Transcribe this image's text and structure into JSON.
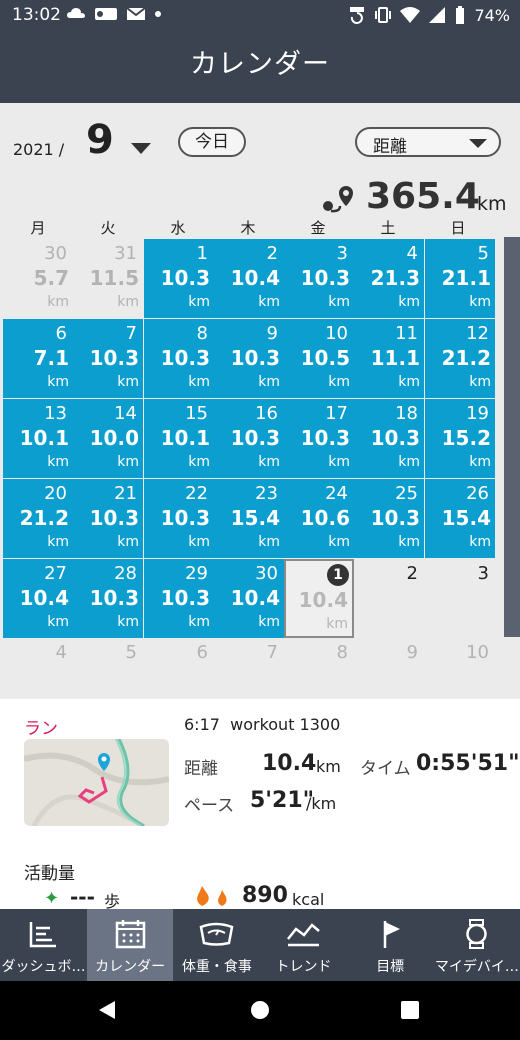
{
  "status_bar": {
    "time": "13:02",
    "battery": "74%",
    "left_icons": [
      "cloud-icon",
      "rec-icon",
      "mail-icon"
    ]
  },
  "header": {
    "title": "カレンダー"
  },
  "controls": {
    "year": "2021 /",
    "month": "9",
    "today_button": "今日",
    "metric_select": "距離",
    "total_value": "365.4",
    "total_unit": "km"
  },
  "weekdays": [
    "月",
    "火",
    "水",
    "木",
    "金",
    "土",
    "日"
  ],
  "calendar": {
    "cells": [
      {
        "day": "30",
        "value": "5.7",
        "unit": "km",
        "state": "grey"
      },
      {
        "day": "31",
        "value": "11.5",
        "unit": "km",
        "state": "grey"
      },
      {
        "day": "1",
        "value": "10.3",
        "unit": "km",
        "state": "filled"
      },
      {
        "day": "2",
        "value": "10.4",
        "unit": "km",
        "state": "filled"
      },
      {
        "day": "3",
        "value": "10.3",
        "unit": "km",
        "state": "filled"
      },
      {
        "day": "4",
        "value": "21.3",
        "unit": "km",
        "state": "filled"
      },
      {
        "day": "5",
        "value": "21.1",
        "unit": "km",
        "state": "filled"
      },
      {
        "day": "6",
        "value": "7.1",
        "unit": "km",
        "state": "filled"
      },
      {
        "day": "7",
        "value": "10.3",
        "unit": "km",
        "state": "filled"
      },
      {
        "day": "8",
        "value": "10.3",
        "unit": "km",
        "state": "filled"
      },
      {
        "day": "9",
        "value": "10.3",
        "unit": "km",
        "state": "filled"
      },
      {
        "day": "10",
        "value": "10.5",
        "unit": "km",
        "state": "filled"
      },
      {
        "day": "11",
        "value": "11.1",
        "unit": "km",
        "state": "filled"
      },
      {
        "day": "12",
        "value": "21.2",
        "unit": "km",
        "state": "filled"
      },
      {
        "day": "13",
        "value": "10.1",
        "unit": "km",
        "state": "filled"
      },
      {
        "day": "14",
        "value": "10.0",
        "unit": "km",
        "state": "filled"
      },
      {
        "day": "15",
        "value": "10.1",
        "unit": "km",
        "state": "filled"
      },
      {
        "day": "16",
        "value": "10.3",
        "unit": "km",
        "state": "filled"
      },
      {
        "day": "17",
        "value": "10.3",
        "unit": "km",
        "state": "filled"
      },
      {
        "day": "18",
        "value": "10.3",
        "unit": "km",
        "state": "filled"
      },
      {
        "day": "19",
        "value": "15.2",
        "unit": "km",
        "state": "filled"
      },
      {
        "day": "20",
        "value": "21.2",
        "unit": "km",
        "state": "filled"
      },
      {
        "day": "21",
        "value": "10.3",
        "unit": "km",
        "state": "filled"
      },
      {
        "day": "22",
        "value": "10.3",
        "unit": "km",
        "state": "filled"
      },
      {
        "day": "23",
        "value": "15.4",
        "unit": "km",
        "state": "filled"
      },
      {
        "day": "24",
        "value": "10.6",
        "unit": "km",
        "state": "filled"
      },
      {
        "day": "25",
        "value": "10.3",
        "unit": "km",
        "state": "filled"
      },
      {
        "day": "26",
        "value": "15.4",
        "unit": "km",
        "state": "filled"
      },
      {
        "day": "27",
        "value": "10.4",
        "unit": "km",
        "state": "filled"
      },
      {
        "day": "28",
        "value": "10.3",
        "unit": "km",
        "state": "filled"
      },
      {
        "day": "29",
        "value": "10.3",
        "unit": "km",
        "state": "filled"
      },
      {
        "day": "30",
        "value": "10.4",
        "unit": "km",
        "state": "filled"
      },
      {
        "day": "1",
        "value": "10.4",
        "unit": "km",
        "state": "today"
      },
      {
        "day": "2",
        "value": "",
        "unit": "",
        "state": "empty"
      },
      {
        "day": "3",
        "value": "",
        "unit": "",
        "state": "empty"
      }
    ],
    "next_row": [
      "4",
      "5",
      "6",
      "7",
      "8",
      "9",
      "10"
    ]
  },
  "detail": {
    "activity_type": "ラン",
    "time": "6:17",
    "workout_name": "workout 1300",
    "distance_label": "距離",
    "distance_value": "10.4",
    "distance_unit": "km",
    "time_label": "タイム",
    "time_value": "0:55'51\"",
    "pace_label": "ペース",
    "pace_value": "5'21\"",
    "pace_unit": "/km",
    "activity_title": "活動量",
    "steps_value": "---",
    "steps_unit": "歩",
    "kcal_value": "890",
    "kcal_unit": "kcal"
  },
  "bottom_nav": [
    {
      "label": "ダッシュボ…",
      "icon": "dashboard-icon",
      "active": false
    },
    {
      "label": "カレンダー",
      "icon": "calendar-icon",
      "active": true
    },
    {
      "label": "体重・食事",
      "icon": "scale-icon",
      "active": false
    },
    {
      "label": "トレンド",
      "icon": "trend-icon",
      "active": false
    },
    {
      "label": "目標",
      "icon": "flag-icon",
      "active": false
    },
    {
      "label": "マイデバイ…",
      "icon": "watch-icon",
      "active": false
    }
  ],
  "colors": {
    "accent": "#0b9ecf",
    "header_bg": "#3b4250",
    "run_red": "#d8195a"
  }
}
